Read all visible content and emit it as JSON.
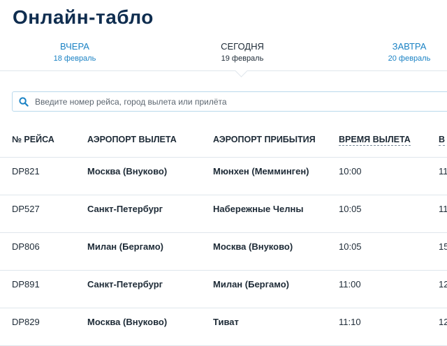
{
  "page": {
    "title": "Онлайн-табло"
  },
  "day_tabs": [
    {
      "label": "ВЧЕРА",
      "date": "18 февраль",
      "active": false
    },
    {
      "label": "СЕГОДНЯ",
      "date": "19 февраль",
      "active": true
    },
    {
      "label": "ЗАВТРА",
      "date": "20 февраль",
      "active": false
    }
  ],
  "search": {
    "placeholder": "Введите номер рейса, город вылета или прилёта",
    "value": ""
  },
  "table": {
    "columns": [
      "№ РЕЙСА",
      "АЭРОПОРТ ВЫЛЕТА",
      "АЭРОПОРТ ПРИБЫТИЯ",
      "ВРЕМЯ ВЫЛЕТА",
      "В"
    ],
    "rows": [
      {
        "flight": "DP821",
        "departure": "Москва (Внуково)",
        "arrival": "Мюнхен (Мемминген)",
        "dep_time": "10:00",
        "arr_time": "11"
      },
      {
        "flight": "DP527",
        "departure": "Санкт-Петербург",
        "arrival": "Набережные Челны",
        "dep_time": "10:05",
        "arr_time": "11"
      },
      {
        "flight": "DP806",
        "departure": "Милан (Бергамо)",
        "arrival": "Москва (Внуково)",
        "dep_time": "10:05",
        "arr_time": "15"
      },
      {
        "flight": "DP891",
        "departure": "Санкт-Петербург",
        "arrival": "Милан (Бергамо)",
        "dep_time": "11:00",
        "arr_time": "12"
      },
      {
        "flight": "DP829",
        "departure": "Москва (Внуково)",
        "arrival": "Тиват",
        "dep_time": "11:10",
        "arr_time": "12"
      }
    ]
  },
  "colors": {
    "title": "#0f2d4f",
    "link": "#1a82c4",
    "divider": "#dfe6ec",
    "search_border": "#b9d9ec"
  },
  "icons": {
    "search": "search-icon"
  }
}
